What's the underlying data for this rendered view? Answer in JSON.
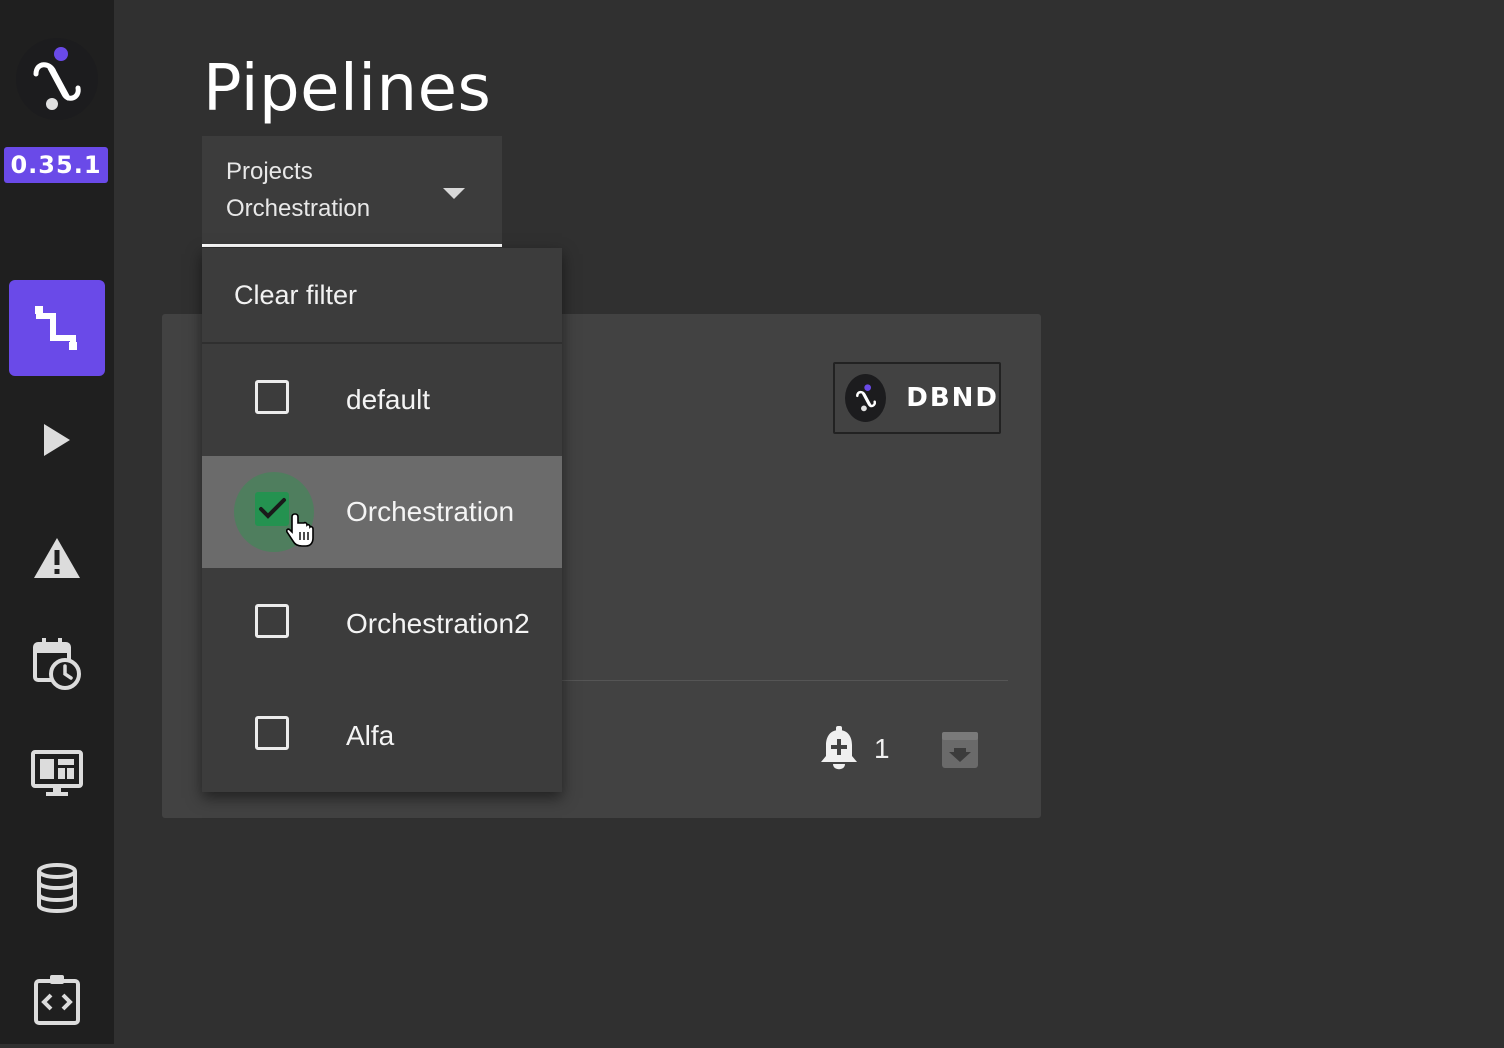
{
  "app": {
    "version": "0.35.1"
  },
  "sidebar": {
    "items": [
      {
        "name": "pipelines",
        "icon": "pipeline-icon",
        "active": true
      },
      {
        "name": "runs",
        "icon": "play-icon",
        "active": false
      },
      {
        "name": "alerts",
        "icon": "warning-icon",
        "active": false
      },
      {
        "name": "schedules",
        "icon": "calendar-clock-icon",
        "active": false
      },
      {
        "name": "monitoring",
        "icon": "monitor-dashboard-icon",
        "active": false
      },
      {
        "name": "datasets",
        "icon": "database-icon",
        "active": false
      },
      {
        "name": "integrations",
        "icon": "code-clipboard-icon",
        "active": false
      }
    ]
  },
  "page": {
    "title": "Pipelines"
  },
  "filter": {
    "label": "Projects",
    "value": "Orchestration"
  },
  "dropdown": {
    "clear_label": "Clear filter",
    "options": [
      {
        "label": "default",
        "checked": false
      },
      {
        "label": "Orchestration",
        "checked": true
      },
      {
        "label": "Orchestration2",
        "checked": false
      },
      {
        "label": "Alfa",
        "checked": false
      }
    ]
  },
  "card": {
    "source_chip": "DBND",
    "alert_count": "1"
  },
  "colors": {
    "accent": "#6a4ae8",
    "sidebar_bg": "#1f1f1f",
    "page_bg": "#303030",
    "card_bg": "#424242",
    "checkbox_checked": "#249250"
  }
}
